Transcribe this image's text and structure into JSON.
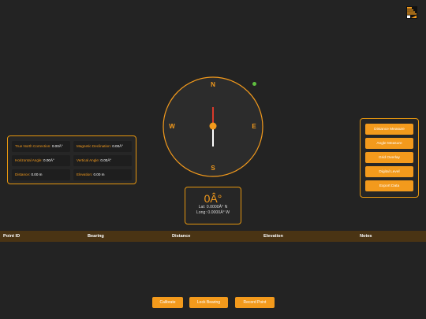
{
  "compass": {
    "north": "N",
    "south": "S",
    "east": "E",
    "west": "W",
    "colors": {
      "ring": "#f39a1c",
      "needle_north": "#d93a2b",
      "needle_south": "#ffffff",
      "face": "#2c2c2c"
    }
  },
  "status": {
    "color": "#5fbf3f"
  },
  "info": {
    "true_north_label": "True North Correction:",
    "true_north_value": "0.00Â°",
    "magnetic_label": "Magnetic Declination:",
    "magnetic_value": "0.00Â°",
    "horizontal_label": "Horizontal Angle:",
    "horizontal_value": "0.00Â°",
    "vertical_label": "Vertical Angle:",
    "vertical_value": "0.00Â°",
    "distance_label": "Distance:",
    "distance_value": "0.00 m",
    "elevation_label": "Elevation:",
    "elevation_value": "0.00 m"
  },
  "tools": [
    "Distance Measure",
    "Angle Measure",
    "Grid Overlay",
    "Digital Level",
    "Export Data"
  ],
  "bearing": {
    "value": "0Â°",
    "lat": "Lat: 0.0000Â° N",
    "long": "Long: 0.0000Â° W"
  },
  "table": {
    "columns": [
      "Point ID",
      "Bearing",
      "Distance",
      "Elevation",
      "Notes"
    ]
  },
  "actions": {
    "calibrate": "Calibrate",
    "lock_bearing": "Lock Bearing",
    "record_point": "Record Point"
  },
  "theme": {
    "accent": "#f39a1c",
    "background": "#232323",
    "header": "#4a3414"
  }
}
